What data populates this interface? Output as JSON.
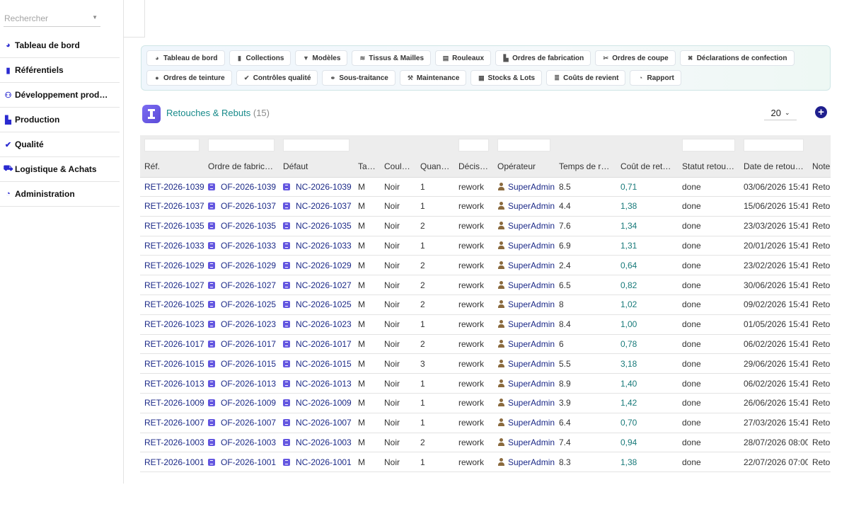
{
  "search": {
    "placeholder": "Rechercher"
  },
  "sidebar": {
    "items": [
      {
        "label": "Tableau de bord",
        "icon": "gauge-icon"
      },
      {
        "label": "Référentiels",
        "icon": "book-icon"
      },
      {
        "label": "Développement prod…",
        "icon": "users-icon"
      },
      {
        "label": "Production",
        "icon": "factory-icon"
      },
      {
        "label": "Qualité",
        "icon": "check-circle-icon"
      },
      {
        "label": "Logistique & Achats",
        "icon": "truck-icon"
      },
      {
        "label": "Administration",
        "icon": "pie-chart-icon"
      }
    ]
  },
  "nav": {
    "row1": [
      {
        "label": "Tableau de bord",
        "icon": "gauge-icon"
      },
      {
        "label": "Collections",
        "icon": "book-icon"
      },
      {
        "label": "Modèles",
        "icon": "shirt-icon"
      },
      {
        "label": "Tissus & Mailles",
        "icon": "layers-icon"
      },
      {
        "label": "Rouleaux",
        "icon": "scroll-icon"
      },
      {
        "label": "Ordres de fabrication",
        "icon": "factory-icon"
      },
      {
        "label": "Ordres de coupe",
        "icon": "scissors-icon"
      },
      {
        "label": "Déclarations de confection",
        "icon": "tools-icon"
      }
    ],
    "row2": [
      {
        "label": "Ordres de teinture",
        "icon": "droplet-icon"
      },
      {
        "label": "Contrôles qualité",
        "icon": "check-circle-icon"
      },
      {
        "label": "Sous-traitance",
        "icon": "handshake-icon"
      },
      {
        "label": "Maintenance",
        "icon": "wrench-icon"
      },
      {
        "label": "Stocks & Lots",
        "icon": "warehouse-icon"
      },
      {
        "label": "Coûts de revient",
        "icon": "coins-icon"
      },
      {
        "label": "Rapport",
        "icon": "pie-chart-icon"
      }
    ]
  },
  "page": {
    "title": "Retouches & Rebuts",
    "count": "(15)",
    "page_size": "20"
  },
  "table": {
    "columns": [
      "Réf.",
      "Ordre de fabrica…",
      "Défaut",
      "Taille",
      "Couleur",
      "Quantité",
      "Décision",
      "Opérateur",
      "Temps de ret…",
      "Coût de reto…",
      "Statut retouche",
      "Date de retouche",
      "Note"
    ],
    "rows": [
      [
        "RET-2026-1039",
        "OF-2026-1039",
        "NC-2026-1039",
        "M",
        "Noir",
        "1",
        "rework",
        "SuperAdmin",
        "8.5",
        "0,71",
        "done",
        "03/06/2026 15:41",
        "Retou"
      ],
      [
        "RET-2026-1037",
        "OF-2026-1037",
        "NC-2026-1037",
        "M",
        "Noir",
        "1",
        "rework",
        "SuperAdmin",
        "4.4",
        "1,38",
        "done",
        "15/06/2026 15:41",
        "Retou"
      ],
      [
        "RET-2026-1035",
        "OF-2026-1035",
        "NC-2026-1035",
        "M",
        "Noir",
        "2",
        "rework",
        "SuperAdmin",
        "7.6",
        "1,34",
        "done",
        "23/03/2026 15:41",
        "Retou"
      ],
      [
        "RET-2026-1033",
        "OF-2026-1033",
        "NC-2026-1033",
        "M",
        "Noir",
        "1",
        "rework",
        "SuperAdmin",
        "6.9",
        "1,31",
        "done",
        "20/01/2026 15:41",
        "Retou"
      ],
      [
        "RET-2026-1029",
        "OF-2026-1029",
        "NC-2026-1029",
        "M",
        "Noir",
        "2",
        "rework",
        "SuperAdmin",
        "2.4",
        "0,64",
        "done",
        "23/02/2026 15:41",
        "Retou"
      ],
      [
        "RET-2026-1027",
        "OF-2026-1027",
        "NC-2026-1027",
        "M",
        "Noir",
        "2",
        "rework",
        "SuperAdmin",
        "6.5",
        "0,82",
        "done",
        "30/06/2026 15:41",
        "Retou"
      ],
      [
        "RET-2026-1025",
        "OF-2026-1025",
        "NC-2026-1025",
        "M",
        "Noir",
        "2",
        "rework",
        "SuperAdmin",
        "8",
        "1,02",
        "done",
        "09/02/2026 15:41",
        "Retou"
      ],
      [
        "RET-2026-1023",
        "OF-2026-1023",
        "NC-2026-1023",
        "M",
        "Noir",
        "1",
        "rework",
        "SuperAdmin",
        "8.4",
        "1,00",
        "done",
        "01/05/2026 15:41",
        "Retou"
      ],
      [
        "RET-2026-1017",
        "OF-2026-1017",
        "NC-2026-1017",
        "M",
        "Noir",
        "2",
        "rework",
        "SuperAdmin",
        "6",
        "0,78",
        "done",
        "06/02/2026 15:41",
        "Retou"
      ],
      [
        "RET-2026-1015",
        "OF-2026-1015",
        "NC-2026-1015",
        "M",
        "Noir",
        "3",
        "rework",
        "SuperAdmin",
        "5.5",
        "3,18",
        "done",
        "29/06/2026 15:41",
        "Retou"
      ],
      [
        "RET-2026-1013",
        "OF-2026-1013",
        "NC-2026-1013",
        "M",
        "Noir",
        "1",
        "rework",
        "SuperAdmin",
        "8.9",
        "1,40",
        "done",
        "06/02/2026 15:41",
        "Retou"
      ],
      [
        "RET-2026-1009",
        "OF-2026-1009",
        "NC-2026-1009",
        "M",
        "Noir",
        "1",
        "rework",
        "SuperAdmin",
        "3.9",
        "1,42",
        "done",
        "26/06/2026 15:41",
        "Retou"
      ],
      [
        "RET-2026-1007",
        "OF-2026-1007",
        "NC-2026-1007",
        "M",
        "Noir",
        "1",
        "rework",
        "SuperAdmin",
        "6.4",
        "0,70",
        "done",
        "27/03/2026 15:41",
        "Retou"
      ],
      [
        "RET-2026-1003",
        "OF-2026-1003",
        "NC-2026-1003",
        "M",
        "Noir",
        "2",
        "rework",
        "SuperAdmin",
        "7.4",
        "0,94",
        "done",
        "28/07/2026 08:00",
        "Retou"
      ],
      [
        "RET-2026-1001",
        "OF-2026-1001",
        "NC-2026-1001",
        "M",
        "Noir",
        "1",
        "rework",
        "SuperAdmin",
        "8.3",
        "1,38",
        "done",
        "22/07/2026 07:00",
        "Retou"
      ]
    ]
  },
  "colors": {
    "accent": "#178a8a",
    "link": "#1c2a88",
    "icon": "#6457e0",
    "add": "#1f1f8e"
  }
}
